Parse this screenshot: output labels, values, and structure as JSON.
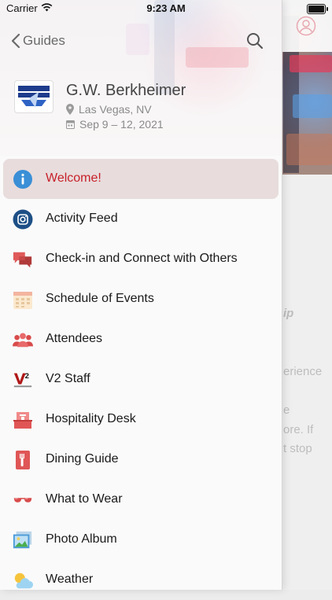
{
  "status_bar": {
    "carrier": "Carrier",
    "time": "9:23 AM"
  },
  "nav": {
    "back_label": "Guides"
  },
  "event": {
    "logo_text": "BERKHEIMER",
    "title": "G.W. Berkheimer",
    "location": "Las Vegas, NV",
    "dates": "Sep 9 – 12, 2021"
  },
  "menu": {
    "items": [
      {
        "label": "Welcome!",
        "icon": "info-icon",
        "active": true
      },
      {
        "label": "Activity Feed",
        "icon": "instagram-icon",
        "active": false
      },
      {
        "label": "Check-in and Connect with Others",
        "icon": "chat-bubbles-icon",
        "active": false
      },
      {
        "label": "Schedule of Events",
        "icon": "calendar-icon",
        "active": false
      },
      {
        "label": "Attendees",
        "icon": "people-icon",
        "active": false
      },
      {
        "label": "V2 Staff",
        "icon": "v2-logo-icon",
        "active": false
      },
      {
        "label": "Hospitality Desk",
        "icon": "desk-icon",
        "active": false
      },
      {
        "label": "Dining Guide",
        "icon": "dining-icon",
        "active": false
      },
      {
        "label": "What to Wear",
        "icon": "sunglasses-icon",
        "active": false
      },
      {
        "label": "Photo Album",
        "icon": "photo-icon",
        "active": false
      },
      {
        "label": "Weather",
        "icon": "weather-icon",
        "active": false
      }
    ]
  },
  "background": {
    "fragments": [
      "ip",
      "erience",
      "e",
      "ore. If",
      "t stop"
    ]
  },
  "colors": {
    "accent": "#c8202a",
    "active_bg": "#e8dcdc"
  }
}
